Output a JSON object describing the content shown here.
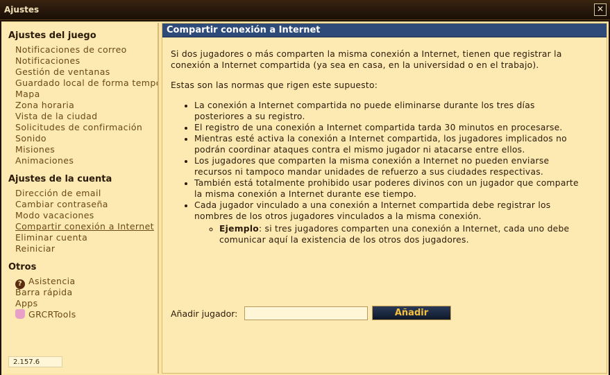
{
  "window": {
    "title": "Ajustes",
    "close_symbol": "✕"
  },
  "sidebar": {
    "sections": [
      {
        "title": "Ajustes del juego",
        "items": [
          {
            "label": "Notificaciones de correo"
          },
          {
            "label": "Notificaciones"
          },
          {
            "label": "Gestión de ventanas"
          },
          {
            "label": "Guardado local de forma tempo"
          },
          {
            "label": "Mapa"
          },
          {
            "label": "Zona horaria"
          },
          {
            "label": "Vista de la ciudad"
          },
          {
            "label": "Solicitudes de confirmación"
          },
          {
            "label": "Sonido"
          },
          {
            "label": "Misiones"
          },
          {
            "label": "Animaciones"
          }
        ]
      },
      {
        "title": "Ajustes de la cuenta",
        "items": [
          {
            "label": "Dirección de email"
          },
          {
            "label": "Cambiar contraseña"
          },
          {
            "label": "Modo vacaciones"
          },
          {
            "label": "Compartir conexión a Internet",
            "active": true
          },
          {
            "label": "Eliminar cuenta"
          },
          {
            "label": "Reiniciar"
          }
        ]
      },
      {
        "title": "Otros",
        "items": [
          {
            "label": "Asistencia",
            "icon": "help-icon"
          },
          {
            "label": "Barra rápida"
          },
          {
            "label": "Apps"
          },
          {
            "label": "GRCRTools",
            "icon": "grcrtools-icon"
          }
        ]
      }
    ],
    "version": "2.157.6"
  },
  "main": {
    "header": "Compartir conexión a Internet",
    "intro": "Si dos jugadores o más comparten la misma conexión a Internet, tienen que registrar la conexión a Internet compartida (ya sea en casa, en la universidad o en el trabajo).",
    "rules_intro": "Estas son las normas que rigen este supuesto:",
    "rules": [
      "La conexión a Internet compartida no puede eliminarse durante los tres días posteriores a su registro.",
      "El registro de una conexión a Internet compartida tarda 30 minutos en procesarse.",
      "Mientras esté activa la conexión a Internet compartida, los jugadores implicados no podrán coordinar ataques contra el mismo jugador ni atacarse entre ellos.",
      "Los jugadores que comparten la misma conexión a Internet no pueden enviarse recursos ni tampoco mandar unidades de refuerzo a sus ciudades respectivas.",
      "También está totalmente prohibido usar poderes divinos con un jugador que comparte la misma conexión a Internet durante ese tiempo.",
      "Cada jugador vinculado a una conexión a Internet compartida debe registrar los nombres de los otros jugadores vinculados a la misma conexión."
    ],
    "example_label": "Ejemplo",
    "example_text": ": si tres jugadores comparten una conexión a Internet, cada uno debe comunicar aquí la existencia de los otros dos jugadores.",
    "add_label": "Añadir jugador:",
    "add_value": "",
    "add_button": "Añadir"
  }
}
